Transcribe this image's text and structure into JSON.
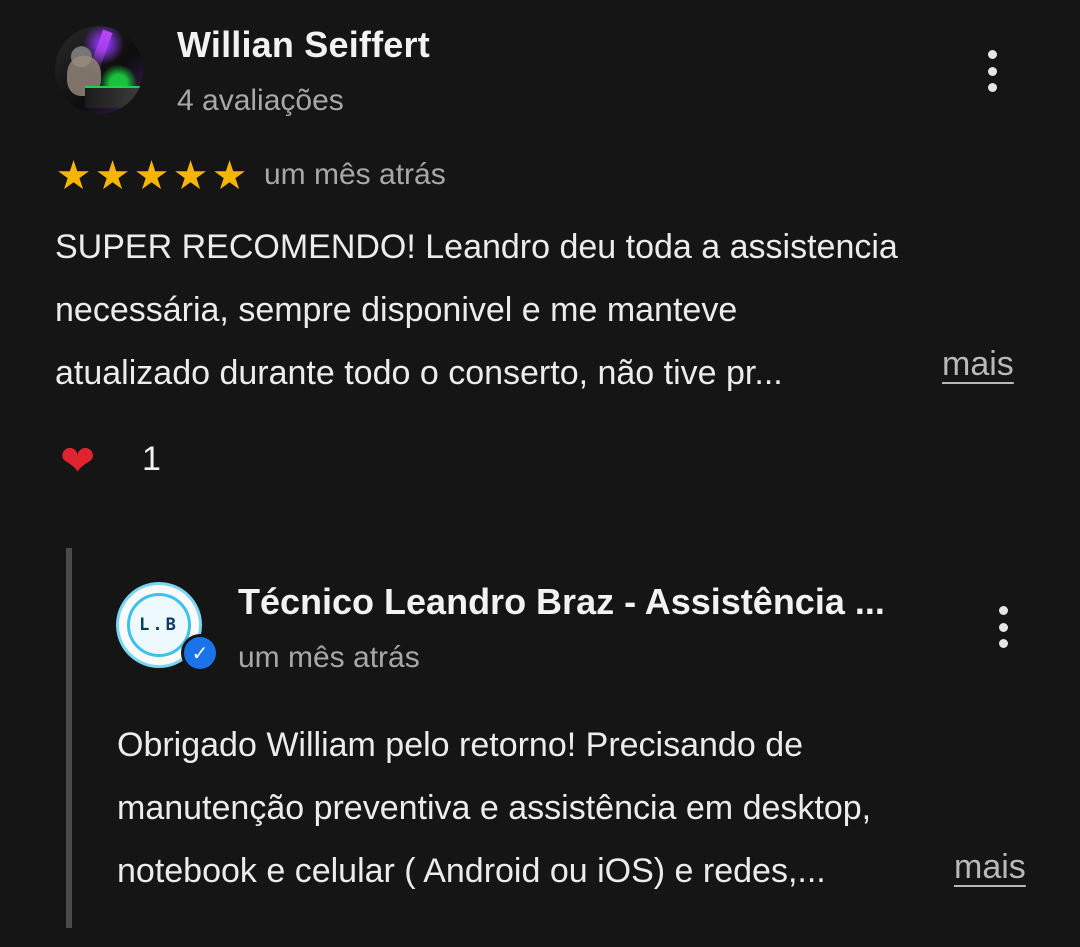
{
  "review": {
    "author_name": "Willian Seiffert",
    "author_review_count": "4 avaliações",
    "rating": 5,
    "rating_max": 5,
    "stars": [
      "★",
      "★",
      "★",
      "★",
      "★"
    ],
    "time": "um mês atrás",
    "text_lines": [
      "SUPER RECOMENDO! Leandro deu toda a assistencia",
      "necessária, sempre disponivel e me manteve",
      "atualizado durante todo o conserto, não tive pr..."
    ],
    "more_label": "mais",
    "reaction_icon": "heart-icon",
    "reaction_glyph": "❤",
    "reaction_count": "1"
  },
  "reply": {
    "owner_name": "Técnico Leandro Braz - Assistência ...",
    "avatar_text": "L.B",
    "verified_glyph": "✓",
    "time": "um mês atrás",
    "text_lines": [
      "Obrigado William pelo retorno! Precisando de",
      "manutenção preventiva e assistência em desktop,",
      "notebook e celular ( Android ou iOS) e redes,..."
    ],
    "more_label": "mais"
  },
  "colors": {
    "background": "#151515",
    "star": "#f7b500",
    "heart": "#e0242f",
    "verified": "#1a73e8",
    "secondary_text": "#a8a8a8"
  }
}
